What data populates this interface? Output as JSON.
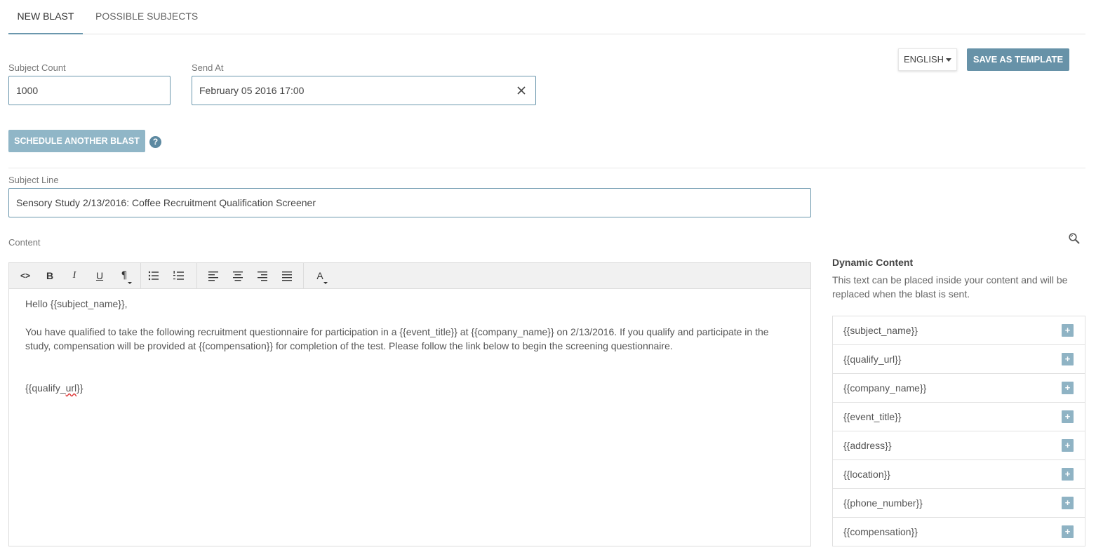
{
  "tabs": [
    {
      "label": "NEW BLAST"
    },
    {
      "label": "POSSIBLE SUBJECTS"
    }
  ],
  "subject_count": {
    "label": "Subject Count",
    "value": "1000"
  },
  "send_at": {
    "label": "Send At",
    "value": "February 05 2016 17:00"
  },
  "language_button": {
    "label": "ENGLISH"
  },
  "save_template_button": {
    "label": "SAVE AS TEMPLATE"
  },
  "schedule_button": {
    "label": "SCHEDULE ANOTHER BLAST"
  },
  "help_icon": {
    "glyph": "?"
  },
  "subject_line": {
    "label": "Subject Line",
    "value": "Sensory Study 2/13/2016: Coffee Recruitment Qualification Screener"
  },
  "content": {
    "label": "Content",
    "toolbar": {
      "code": "<>",
      "bold": "B",
      "italic": "I",
      "underline": "U",
      "paragraph": "¶",
      "bullet_list": "☰",
      "numbered_list": "☰",
      "align_left": "≡",
      "align_center": "≡",
      "align_right": "≡",
      "justify": "≡",
      "font_color": "A"
    },
    "greeting": "Hello  {{subject_name}},",
    "body_line1": "You have qualified to take the following recruitment questionnaire for participation in a {{event_title}} at {{company_name}} on 2/13/2016. If you qualify and participate in the",
    "body_line2": "study, compensation will be provided at {{compensation}} for completion of the test.  Please follow the link below to begin the screening questionnaire.",
    "link_prefix": "{{qualify_",
    "link_word": "url",
    "link_suffix": "}}"
  },
  "dynamic_content": {
    "title": "Dynamic Content",
    "description": "This text can be placed inside your content and will be replaced when the blast is sent.",
    "add_label": "+",
    "items": [
      {
        "label": "{{subject_name}}"
      },
      {
        "label": "{{qualify_url}}"
      },
      {
        "label": "{{company_name}}"
      },
      {
        "label": "{{event_title}}"
      },
      {
        "label": "{{address}}"
      },
      {
        "label": "{{location}}"
      },
      {
        "label": "{{phone_number}}"
      },
      {
        "label": "{{compensation}}"
      }
    ]
  },
  "colors": {
    "accent": "#6792a8",
    "accent_light": "#90b6c7",
    "input_border": "#6b97ad"
  }
}
